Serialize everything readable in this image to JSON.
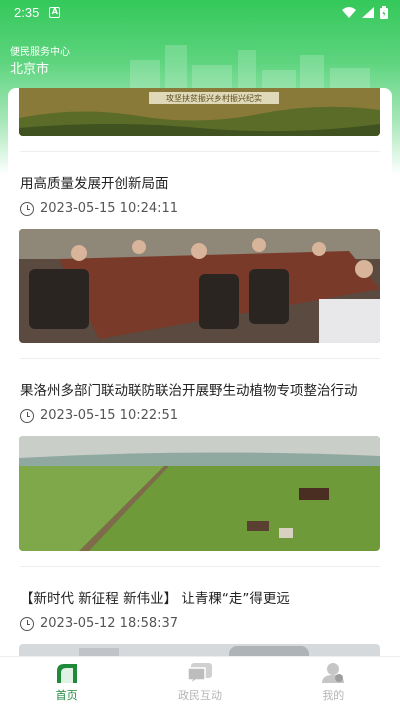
{
  "status_bar": {
    "time": "2:35",
    "a_icon": "A"
  },
  "location": {
    "subtitle": "便民服务中心",
    "city": "北京市"
  },
  "top_banner": {
    "caption": "攻坚扶贫振兴乡村振兴纪实"
  },
  "articles": [
    {
      "title": "用高质量发展开创新局面",
      "time": "2023-05-15 10:24:11",
      "image": "meeting-photo"
    },
    {
      "title": "果洛州多部门联动联防联治开展野生动植物专项整治行动",
      "time": "2023-05-15 10:22:51",
      "image": "grassland-photo"
    },
    {
      "title": "【新时代 新征程 新伟业】 让青稞“走”得更远",
      "time": "2023-05-12 18:58:37",
      "image": "machine-photo"
    }
  ],
  "tabs": [
    {
      "label": "首页",
      "icon": "home-icon",
      "active": true
    },
    {
      "label": "政民互动",
      "icon": "chat-icon",
      "active": false
    },
    {
      "label": "我的",
      "icon": "user-icon",
      "active": false
    }
  ],
  "colors": {
    "accent": "#1f8a3a",
    "header": "#34c85a",
    "inactive": "#b5b5b5"
  }
}
